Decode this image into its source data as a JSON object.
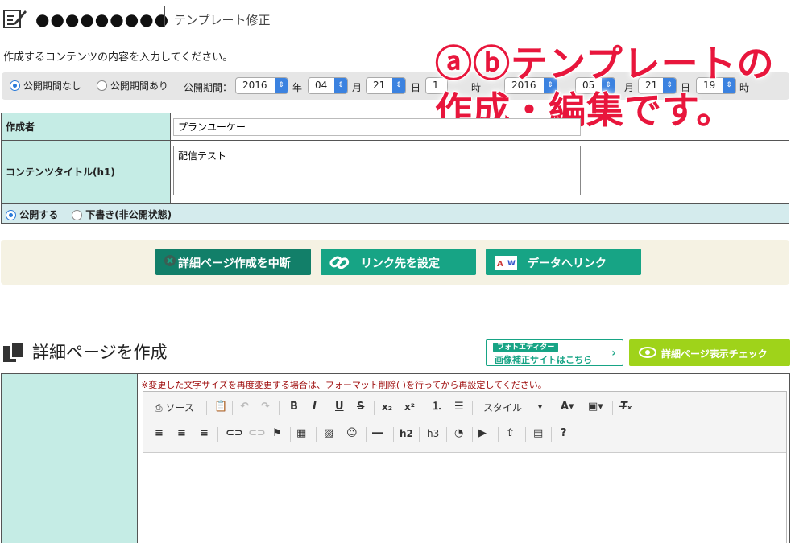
{
  "header": {
    "masked_name": "●●●●●●●●●",
    "title": "テンプレート修正"
  },
  "intro": "作成するコンテンツの内容を入力してください。",
  "period": {
    "none_label": "公開期間なし",
    "has_label": "公開期間あり",
    "label": "公開期間：",
    "start": {
      "year": "2016",
      "month": "04",
      "day": "21",
      "hour": "1"
    },
    "end": {
      "year": "2016",
      "month": "05",
      "day": "21",
      "hour": "19"
    },
    "units": {
      "year": "年",
      "month": "月",
      "day": "日",
      "hour": "時"
    }
  },
  "overlay": {
    "line1": "ⓐⓑテンプレートの",
    "line2": "作成・編集です。"
  },
  "form": {
    "author_label": "作成者",
    "author_value": "プランユーケー",
    "title_label": "コンテンツタイトル(h1)",
    "title_value": "配信テスト",
    "publish_label": "公開する",
    "draft_label": "下書き(非公開状態)"
  },
  "buttons": {
    "cancel": "詳細ページ作成を中断",
    "link": "リンク先を設定",
    "data": "データへリンク"
  },
  "section2": {
    "title": "詳細ページを作成"
  },
  "photo": {
    "badge": "フォトエディター",
    "text": "画像補正サイトはこちら"
  },
  "check": {
    "label": "詳細ページ表示チェック"
  },
  "editor": {
    "notice": "※変更した文字サイズを再度変更する場合は、フォーマット削除( )を行ってから再設定してください。",
    "source": "ソース",
    "style": "スタイル",
    "h2": "h2",
    "h3": "h3"
  }
}
